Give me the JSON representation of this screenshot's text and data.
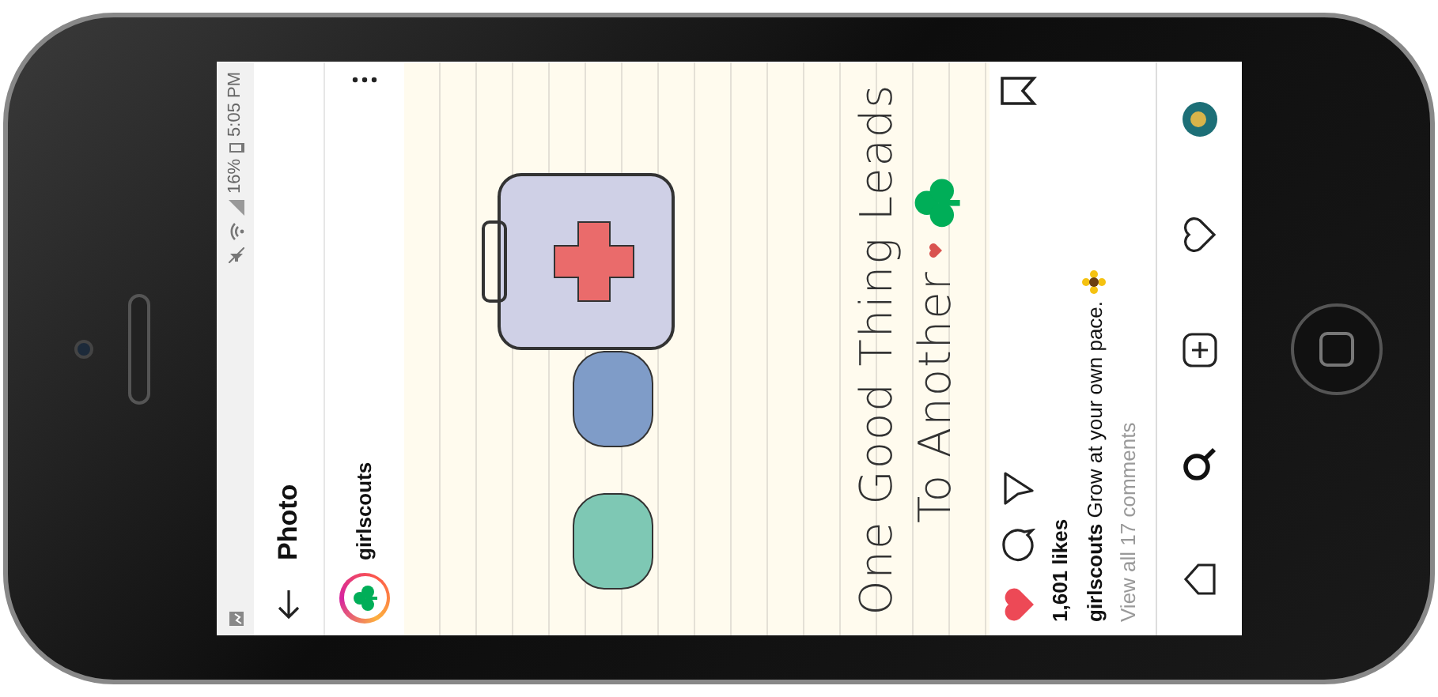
{
  "status_bar": {
    "battery": "16%",
    "time": "5:05 PM"
  },
  "header": {
    "title": "Photo"
  },
  "post": {
    "username": "girlscouts",
    "image": {
      "text_lines": [
        "One Good Thing Leads",
        "To Another"
      ]
    },
    "liked": true,
    "likes": "1,601 likes",
    "caption": "**girlscouts** Grow at your own pace.",
    "comments_link": "View all 17 comments"
  },
  "bottom_nav": [
    {
      "kind": "home",
      "selected": false
    },
    {
      "kind": "search",
      "selected": true
    },
    {
      "kind": "add",
      "selected": false
    },
    {
      "kind": "activity",
      "selected": false
    },
    {
      "kind": "profile",
      "selected": false
    }
  ]
}
